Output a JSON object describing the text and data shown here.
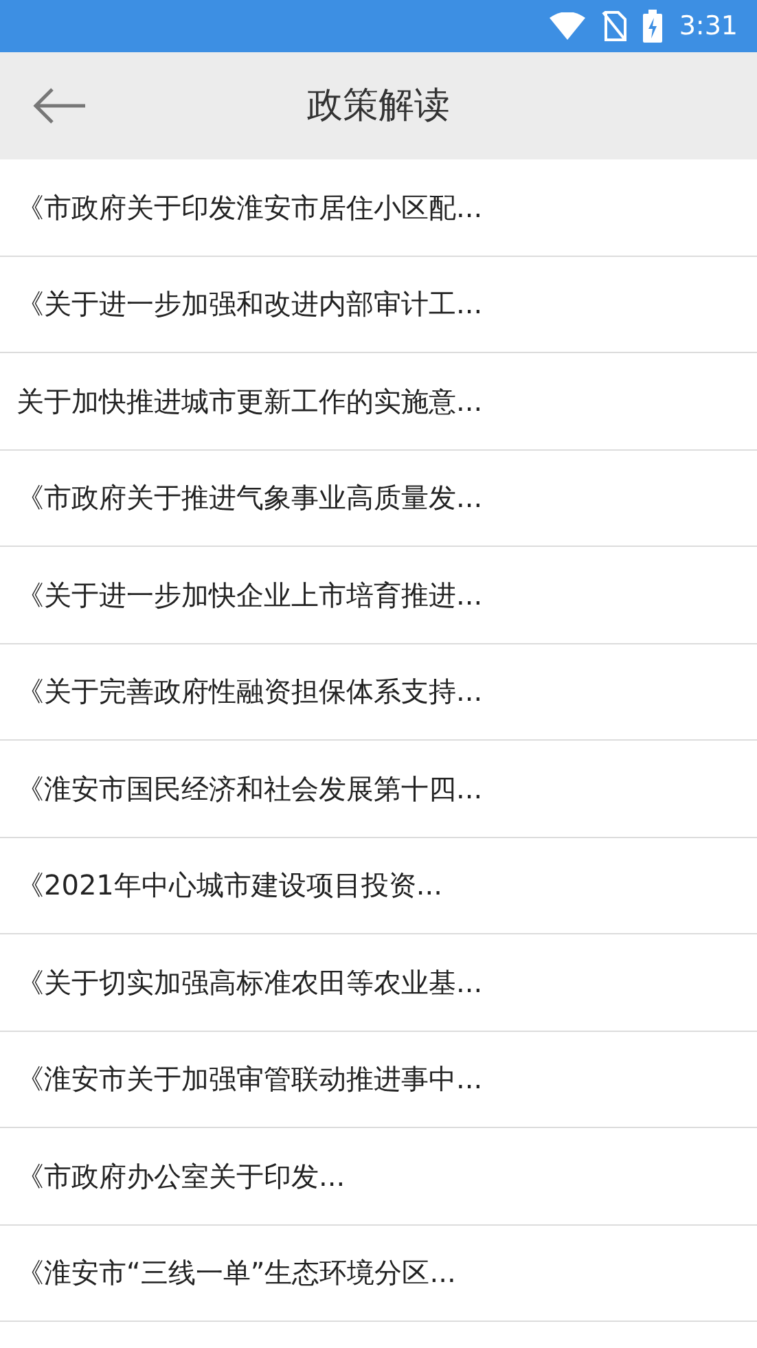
{
  "status_bar": {
    "time": "3:31"
  },
  "header": {
    "title": "政策解读"
  },
  "items": [
    "《市政府关于印发淮安市居住小区配...",
    "《关于进一步加强和改进内部审计工...",
    "关于加快推进城市更新工作的实施意...",
    "《市政府关于推进气象事业高质量发...",
    "《关于进一步加快企业上市培育推进...",
    "《关于完善政府性融资担保体系支持...",
    "《淮安市国民经济和社会发展第十四...",
    "《2021年中心城市建设项目投资...",
    "《关于切实加强高标准农田等农业基...",
    "《淮安市关于加强审管联动推进事中...",
    "《市政府办公室关于印发...",
    "《淮安市“三线一单”生态环境分区..."
  ]
}
